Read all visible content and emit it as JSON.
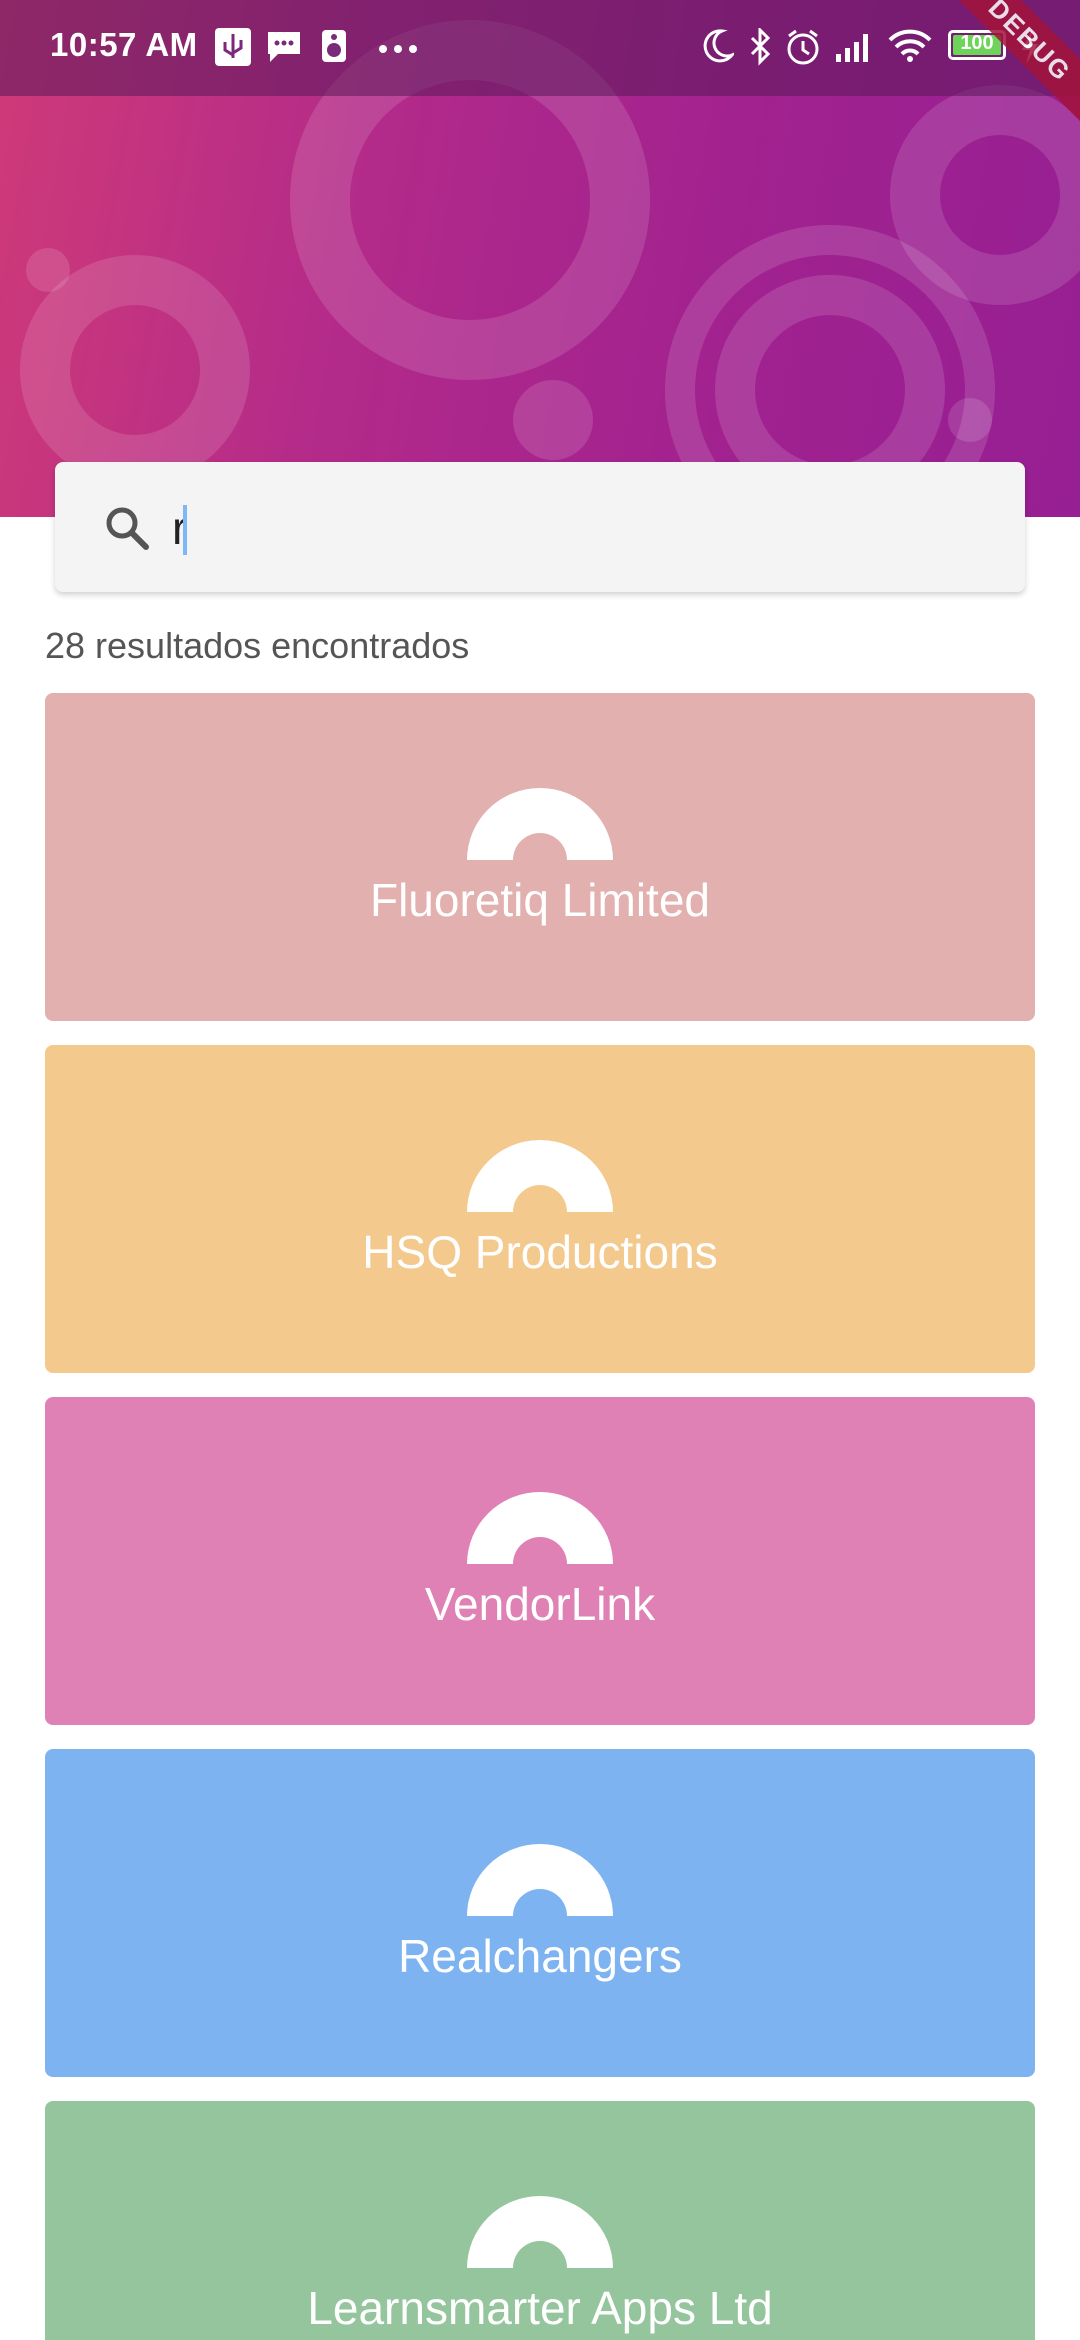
{
  "status_bar": {
    "time": "10:57 AM",
    "battery": "100",
    "debug": "DEBUG"
  },
  "search": {
    "value": "r",
    "placeholder": ""
  },
  "results_text": "28 resultados encontrados",
  "companies": [
    {
      "name": "Fluoretiq Limited",
      "color": "#e2b0ae"
    },
    {
      "name": "HSQ Productions",
      "color": "#f4c98e"
    },
    {
      "name": "VendorLink",
      "color": "#df81b5"
    },
    {
      "name": "Realchangers",
      "color": "#7eb3f1"
    },
    {
      "name": "Learnsmarter Apps Ltd",
      "color": "#94c59c"
    }
  ],
  "icons": {
    "search": "search-icon",
    "logo": "company-logo-icon"
  }
}
